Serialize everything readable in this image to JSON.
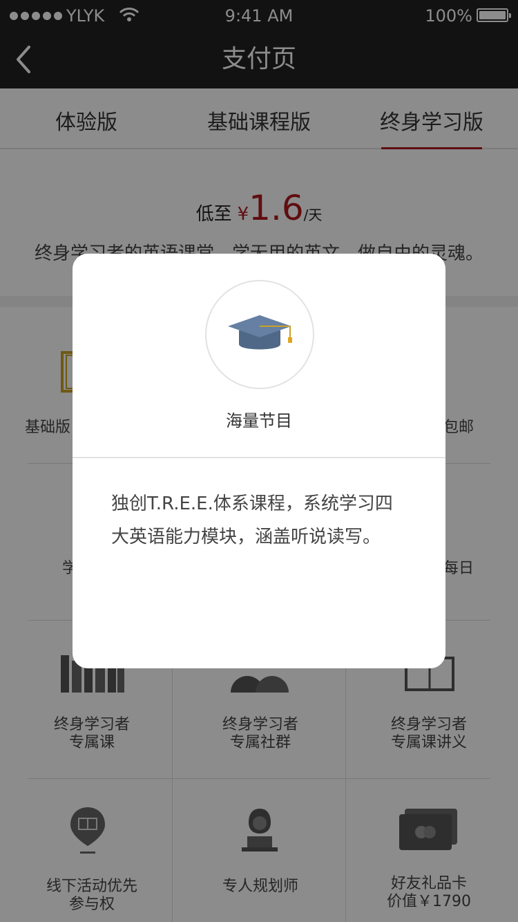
{
  "status_bar": {
    "carrier": "YLYK",
    "time": "9:41 AM",
    "battery": "100%"
  },
  "nav": {
    "title": "支付页"
  },
  "tabs": [
    {
      "label": "体验版"
    },
    {
      "label": "基础课程版"
    },
    {
      "label": "终身学习版",
      "active": true
    }
  ],
  "price": {
    "prefix": "低至",
    "currency": "¥",
    "value": "1.6",
    "unit": "/天"
  },
  "slogan": "终身学习者的英语课堂，学无用的英文，做自由的灵魂。",
  "benefits": {
    "row1_left": "基础版",
    "row1_right": "包邮",
    "row2_left": "学",
    "row2_right": "每日",
    "row3": [
      {
        "line1": "终身学习者",
        "line2": "专属课"
      },
      {
        "line1": "终身学习者",
        "line2": "专属社群"
      },
      {
        "line1": "终身学习者",
        "line2": "专属课讲义"
      }
    ],
    "row4": [
      {
        "line1": "线下活动优先",
        "line2": "参与权"
      },
      {
        "line1": "专人规划师",
        "line2": ""
      },
      {
        "line1": "好友礼品卡",
        "line2": "价值￥1790"
      }
    ]
  },
  "modal": {
    "icon": "graduation-cap-icon",
    "title": "海量节目",
    "description": "独创T.R.E.E.体系课程，系统学习四大英语能力模块，涵盖听说读写。"
  },
  "colors": {
    "accent": "#b0191e",
    "nav_bg": "#222222",
    "gold": "#c9a227"
  }
}
